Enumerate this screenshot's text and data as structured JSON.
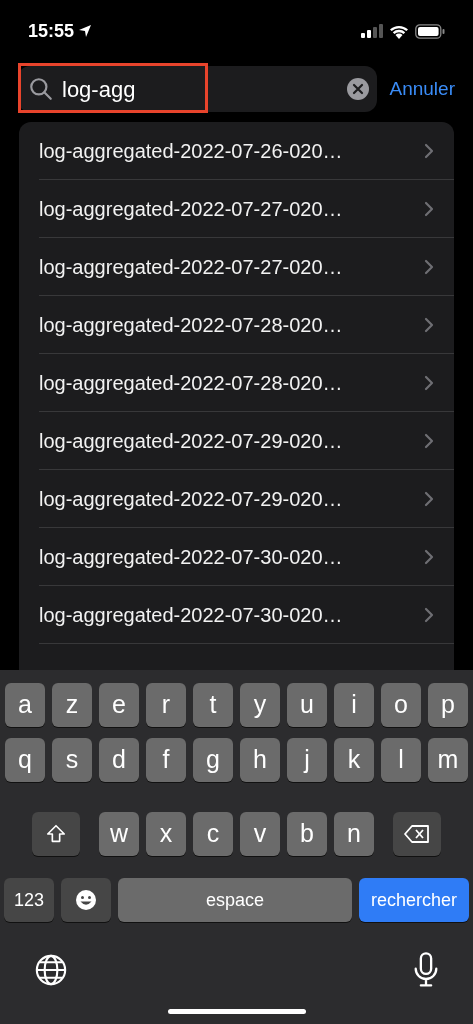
{
  "status_bar": {
    "time": "15:55"
  },
  "search": {
    "value": "log-agg",
    "highlighted": true
  },
  "cancel": "Annuler",
  "results": [
    "log-aggregated-2022-07-26-020…",
    "log-aggregated-2022-07-27-020…",
    "log-aggregated-2022-07-27-020…",
    "log-aggregated-2022-07-28-020…",
    "log-aggregated-2022-07-28-020…",
    "log-aggregated-2022-07-29-020…",
    "log-aggregated-2022-07-29-020…",
    "log-aggregated-2022-07-30-020…",
    "log-aggregated-2022-07-30-020…"
  ],
  "keyboard": {
    "rows": [
      {
        "keys": [
          {
            "kind": "letter",
            "label": "a"
          },
          {
            "kind": "letter",
            "label": "z"
          },
          {
            "kind": "letter",
            "label": "e"
          },
          {
            "kind": "letter",
            "label": "r"
          },
          {
            "kind": "letter",
            "label": "t"
          },
          {
            "kind": "letter",
            "label": "y"
          },
          {
            "kind": "letter",
            "label": "u"
          },
          {
            "kind": "letter",
            "label": "i"
          },
          {
            "kind": "letter",
            "label": "o"
          },
          {
            "kind": "letter",
            "label": "p"
          }
        ]
      },
      {
        "keys": [
          {
            "kind": "letter",
            "label": "q"
          },
          {
            "kind": "letter",
            "label": "s"
          },
          {
            "kind": "letter",
            "label": "d"
          },
          {
            "kind": "letter",
            "label": "f"
          },
          {
            "kind": "letter",
            "label": "g"
          },
          {
            "kind": "letter",
            "label": "h"
          },
          {
            "kind": "letter",
            "label": "j"
          },
          {
            "kind": "letter",
            "label": "k"
          },
          {
            "kind": "letter",
            "label": "l"
          },
          {
            "kind": "letter",
            "label": "m"
          }
        ]
      },
      {
        "keys": [
          {
            "kind": "shift"
          },
          {
            "kind": "letter",
            "label": "w"
          },
          {
            "kind": "letter",
            "label": "x"
          },
          {
            "kind": "letter",
            "label": "c"
          },
          {
            "kind": "letter",
            "label": "v"
          },
          {
            "kind": "letter",
            "label": "b"
          },
          {
            "kind": "letter",
            "label": "n"
          },
          {
            "kind": "backspace"
          }
        ]
      },
      {
        "keys": [
          {
            "kind": "numbers",
            "label": "123"
          },
          {
            "kind": "emoji"
          },
          {
            "kind": "space",
            "label": "espace"
          },
          {
            "kind": "action",
            "label": "rechercher"
          }
        ]
      }
    ]
  }
}
